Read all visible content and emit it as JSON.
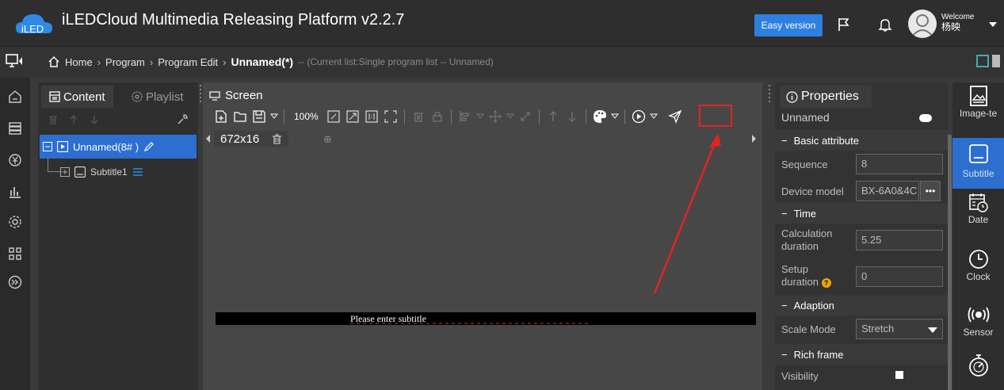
{
  "header": {
    "logo_text": "iLED",
    "title": "iLEDCloud Multimedia Releasing Platform v2.2.7",
    "easy_version_label": "Easy version",
    "welcome_label": "Welcome",
    "user_name": "杨映"
  },
  "breadcrumb": {
    "home": "Home",
    "program": "Program",
    "program_edit": "Program Edit",
    "current": "Unnamed(*)",
    "info": "-- (Current list:Single program list -- Unnamed)"
  },
  "content_panel": {
    "tab_content": "Content",
    "tab_playlist": "Playlist",
    "tree": [
      {
        "label": "Unnamed(8# )"
      },
      {
        "label": "Subtitle1"
      }
    ]
  },
  "screen_panel": {
    "title": "Screen",
    "zoom": "100%",
    "screen_tab": "672x16",
    "subtitle_placeholder": "Please enter subtitle"
  },
  "properties": {
    "tab_label": "Properties",
    "program_name": "Unnamed",
    "sections": {
      "basic": "Basic attribute",
      "time": "Time",
      "adaption": "Adaption",
      "rich_frame": "Rich frame"
    },
    "fields": {
      "sequence_label": "Sequence",
      "sequence_value": "8",
      "device_model_label": "Device model",
      "device_model_value": "BX-6A0&4C",
      "calc_duration_label": "Calculation duration",
      "calc_duration_value": "5.25",
      "setup_duration_label": "Setup duration",
      "setup_duration_value": "0",
      "scale_mode_label": "Scale Mode",
      "scale_mode_value": "Stretch",
      "visibility_label": "Visibility"
    }
  },
  "components": [
    {
      "label": "Image-te",
      "icon": "image-text-icon"
    },
    {
      "label": "Subtitle",
      "icon": "subtitle-icon"
    },
    {
      "label": "Date",
      "icon": "date-icon"
    },
    {
      "label": "Clock",
      "icon": "clock-icon"
    },
    {
      "label": "Sensor",
      "icon": "sensor-icon"
    },
    {
      "label": "",
      "icon": "timer-icon"
    }
  ],
  "colors": {
    "accent": "#2c6fd0",
    "highlight_box": "#e02424",
    "warning": "#f0a800"
  }
}
